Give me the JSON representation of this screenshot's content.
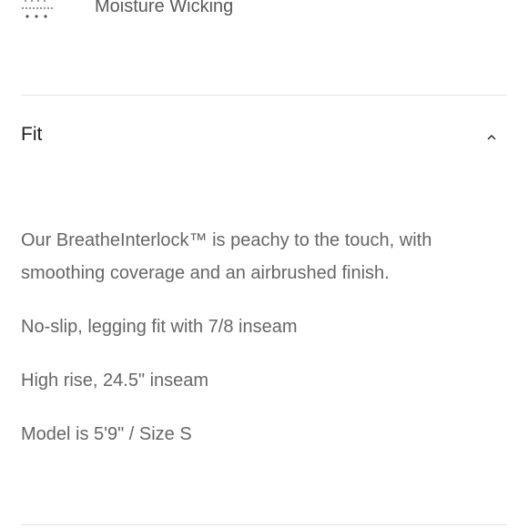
{
  "feature": {
    "icon": "moisture-wicking-icon",
    "label": "Moisture Wicking"
  },
  "accordion": {
    "title": "Fit",
    "expanded": true,
    "chevron_icon": "chevron-up-icon",
    "description": "Our BreatheInterlock™ is peachy to the touch, with smoothing coverage and an airbrushed finish.",
    "details": [
      "No-slip, legging fit with 7/8 inseam",
      "High rise, 24.5\" inseam",
      "Model is 5'9\" / Size S"
    ]
  }
}
